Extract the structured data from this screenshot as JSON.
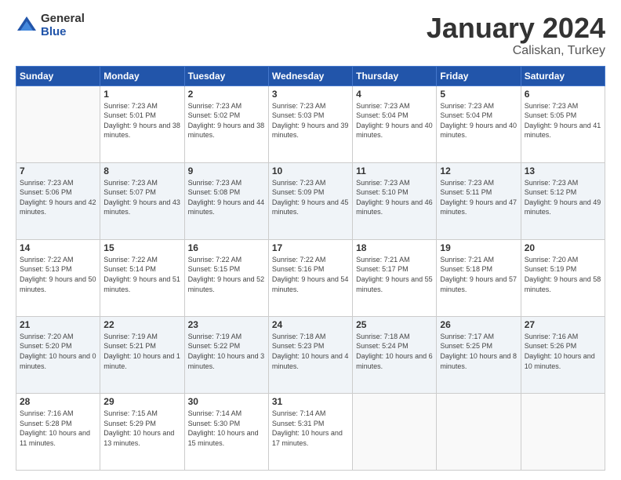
{
  "logo": {
    "general": "General",
    "blue": "Blue"
  },
  "title": "January 2024",
  "location": "Caliskan, Turkey",
  "days_header": [
    "Sunday",
    "Monday",
    "Tuesday",
    "Wednesday",
    "Thursday",
    "Friday",
    "Saturday"
  ],
  "weeks": [
    [
      {
        "day": "",
        "sunrise": "",
        "sunset": "",
        "daylight": ""
      },
      {
        "day": "1",
        "sunrise": "Sunrise: 7:23 AM",
        "sunset": "Sunset: 5:01 PM",
        "daylight": "Daylight: 9 hours and 38 minutes."
      },
      {
        "day": "2",
        "sunrise": "Sunrise: 7:23 AM",
        "sunset": "Sunset: 5:02 PM",
        "daylight": "Daylight: 9 hours and 38 minutes."
      },
      {
        "day": "3",
        "sunrise": "Sunrise: 7:23 AM",
        "sunset": "Sunset: 5:03 PM",
        "daylight": "Daylight: 9 hours and 39 minutes."
      },
      {
        "day": "4",
        "sunrise": "Sunrise: 7:23 AM",
        "sunset": "Sunset: 5:04 PM",
        "daylight": "Daylight: 9 hours and 40 minutes."
      },
      {
        "day": "5",
        "sunrise": "Sunrise: 7:23 AM",
        "sunset": "Sunset: 5:04 PM",
        "daylight": "Daylight: 9 hours and 40 minutes."
      },
      {
        "day": "6",
        "sunrise": "Sunrise: 7:23 AM",
        "sunset": "Sunset: 5:05 PM",
        "daylight": "Daylight: 9 hours and 41 minutes."
      }
    ],
    [
      {
        "day": "7",
        "sunrise": "Sunrise: 7:23 AM",
        "sunset": "Sunset: 5:06 PM",
        "daylight": "Daylight: 9 hours and 42 minutes."
      },
      {
        "day": "8",
        "sunrise": "Sunrise: 7:23 AM",
        "sunset": "Sunset: 5:07 PM",
        "daylight": "Daylight: 9 hours and 43 minutes."
      },
      {
        "day": "9",
        "sunrise": "Sunrise: 7:23 AM",
        "sunset": "Sunset: 5:08 PM",
        "daylight": "Daylight: 9 hours and 44 minutes."
      },
      {
        "day": "10",
        "sunrise": "Sunrise: 7:23 AM",
        "sunset": "Sunset: 5:09 PM",
        "daylight": "Daylight: 9 hours and 45 minutes."
      },
      {
        "day": "11",
        "sunrise": "Sunrise: 7:23 AM",
        "sunset": "Sunset: 5:10 PM",
        "daylight": "Daylight: 9 hours and 46 minutes."
      },
      {
        "day": "12",
        "sunrise": "Sunrise: 7:23 AM",
        "sunset": "Sunset: 5:11 PM",
        "daylight": "Daylight: 9 hours and 47 minutes."
      },
      {
        "day": "13",
        "sunrise": "Sunrise: 7:23 AM",
        "sunset": "Sunset: 5:12 PM",
        "daylight": "Daylight: 9 hours and 49 minutes."
      }
    ],
    [
      {
        "day": "14",
        "sunrise": "Sunrise: 7:22 AM",
        "sunset": "Sunset: 5:13 PM",
        "daylight": "Daylight: 9 hours and 50 minutes."
      },
      {
        "day": "15",
        "sunrise": "Sunrise: 7:22 AM",
        "sunset": "Sunset: 5:14 PM",
        "daylight": "Daylight: 9 hours and 51 minutes."
      },
      {
        "day": "16",
        "sunrise": "Sunrise: 7:22 AM",
        "sunset": "Sunset: 5:15 PM",
        "daylight": "Daylight: 9 hours and 52 minutes."
      },
      {
        "day": "17",
        "sunrise": "Sunrise: 7:22 AM",
        "sunset": "Sunset: 5:16 PM",
        "daylight": "Daylight: 9 hours and 54 minutes."
      },
      {
        "day": "18",
        "sunrise": "Sunrise: 7:21 AM",
        "sunset": "Sunset: 5:17 PM",
        "daylight": "Daylight: 9 hours and 55 minutes."
      },
      {
        "day": "19",
        "sunrise": "Sunrise: 7:21 AM",
        "sunset": "Sunset: 5:18 PM",
        "daylight": "Daylight: 9 hours and 57 minutes."
      },
      {
        "day": "20",
        "sunrise": "Sunrise: 7:20 AM",
        "sunset": "Sunset: 5:19 PM",
        "daylight": "Daylight: 9 hours and 58 minutes."
      }
    ],
    [
      {
        "day": "21",
        "sunrise": "Sunrise: 7:20 AM",
        "sunset": "Sunset: 5:20 PM",
        "daylight": "Daylight: 10 hours and 0 minutes."
      },
      {
        "day": "22",
        "sunrise": "Sunrise: 7:19 AM",
        "sunset": "Sunset: 5:21 PM",
        "daylight": "Daylight: 10 hours and 1 minute."
      },
      {
        "day": "23",
        "sunrise": "Sunrise: 7:19 AM",
        "sunset": "Sunset: 5:22 PM",
        "daylight": "Daylight: 10 hours and 3 minutes."
      },
      {
        "day": "24",
        "sunrise": "Sunrise: 7:18 AM",
        "sunset": "Sunset: 5:23 PM",
        "daylight": "Daylight: 10 hours and 4 minutes."
      },
      {
        "day": "25",
        "sunrise": "Sunrise: 7:18 AM",
        "sunset": "Sunset: 5:24 PM",
        "daylight": "Daylight: 10 hours and 6 minutes."
      },
      {
        "day": "26",
        "sunrise": "Sunrise: 7:17 AM",
        "sunset": "Sunset: 5:25 PM",
        "daylight": "Daylight: 10 hours and 8 minutes."
      },
      {
        "day": "27",
        "sunrise": "Sunrise: 7:16 AM",
        "sunset": "Sunset: 5:26 PM",
        "daylight": "Daylight: 10 hours and 10 minutes."
      }
    ],
    [
      {
        "day": "28",
        "sunrise": "Sunrise: 7:16 AM",
        "sunset": "Sunset: 5:28 PM",
        "daylight": "Daylight: 10 hours and 11 minutes."
      },
      {
        "day": "29",
        "sunrise": "Sunrise: 7:15 AM",
        "sunset": "Sunset: 5:29 PM",
        "daylight": "Daylight: 10 hours and 13 minutes."
      },
      {
        "day": "30",
        "sunrise": "Sunrise: 7:14 AM",
        "sunset": "Sunset: 5:30 PM",
        "daylight": "Daylight: 10 hours and 15 minutes."
      },
      {
        "day": "31",
        "sunrise": "Sunrise: 7:14 AM",
        "sunset": "Sunset: 5:31 PM",
        "daylight": "Daylight: 10 hours and 17 minutes."
      },
      {
        "day": "",
        "sunrise": "",
        "sunset": "",
        "daylight": ""
      },
      {
        "day": "",
        "sunrise": "",
        "sunset": "",
        "daylight": ""
      },
      {
        "day": "",
        "sunrise": "",
        "sunset": "",
        "daylight": ""
      }
    ]
  ]
}
